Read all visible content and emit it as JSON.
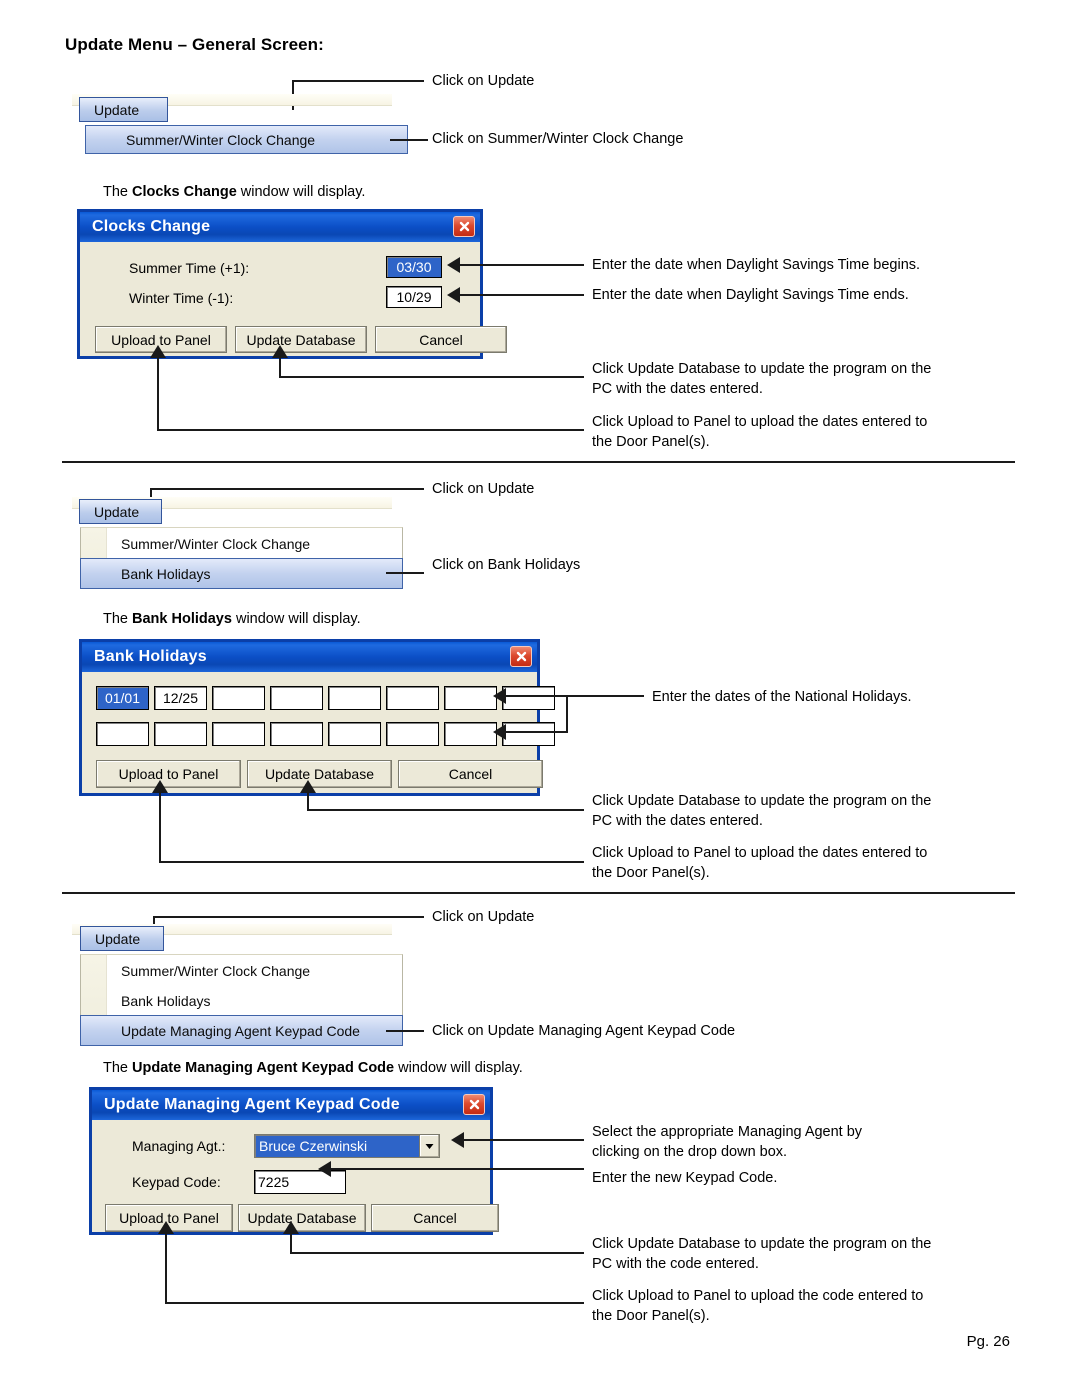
{
  "document": {
    "title": "Update Menu – General Screen:",
    "page_number": "Pg. 26"
  },
  "section1": {
    "menu": {
      "update_label": "Update",
      "items": [
        {
          "label": "Summer/Winter Clock Change",
          "selected": true
        }
      ]
    },
    "callouts": {
      "click_update": "Click on Update",
      "click_item": "Click on Summer/Winter Clock Change"
    },
    "intro_prefix": "The ",
    "intro_bold": "Clocks Change",
    "intro_suffix": " window will display.",
    "dialog": {
      "title": "Clocks Change",
      "close_icon": "close-icon",
      "fields": [
        {
          "label": "Summer Time (+1):",
          "value": "03/30",
          "selected": true
        },
        {
          "label": "Winter Time  (-1):",
          "value": "10/29",
          "selected": false
        }
      ],
      "buttons": [
        "Upload to Panel",
        "Update Database",
        "Cancel"
      ]
    },
    "annotations": {
      "summer": "Enter the date when Daylight Savings Time begins.",
      "winter": "Enter the date when Daylight Savings Time ends.",
      "update_db_l1": "Click Update Database to update the program on the",
      "update_db_l2": "PC with the dates entered.",
      "upload_l1": "Click Upload to Panel to upload the dates entered to",
      "upload_l2": "the Door Panel(s)."
    }
  },
  "section2": {
    "menu": {
      "update_label": "Update",
      "items": [
        {
          "label": "Summer/Winter Clock Change",
          "selected": false
        },
        {
          "label": "Bank Holidays",
          "selected": true
        }
      ]
    },
    "callouts": {
      "click_update": "Click on Update",
      "click_item": "Click on Bank Holidays"
    },
    "intro_prefix": "The ",
    "intro_bold": "Bank Holidays",
    "intro_suffix": " window will display.",
    "dialog": {
      "title": "Bank Holidays",
      "close_icon": "close-icon",
      "row1": [
        "01/01",
        "12/25",
        "",
        "",
        "",
        "",
        "",
        ""
      ],
      "row1_selected_index": 0,
      "row2": [
        "",
        "",
        "",
        "",
        "",
        "",
        "",
        ""
      ],
      "buttons": [
        "Upload to Panel",
        "Update Database",
        "Cancel"
      ]
    },
    "annotations": {
      "dates": "Enter the dates of the National Holidays.",
      "update_db_l1": "Click Update Database to update the program on the",
      "update_db_l2": "PC with the dates entered.",
      "upload_l1": "Click Upload to Panel to upload the dates entered to",
      "upload_l2": "the Door Panel(s)."
    }
  },
  "section3": {
    "menu": {
      "update_label": "Update",
      "items": [
        {
          "label": "Summer/Winter Clock Change",
          "selected": false
        },
        {
          "label": "Bank Holidays",
          "selected": false
        },
        {
          "label": "Update Managing Agent Keypad Code",
          "selected": true
        }
      ]
    },
    "callouts": {
      "click_update": "Click on Update",
      "click_item": "Click on Update Managing Agent Keypad Code"
    },
    "intro_prefix": "The ",
    "intro_bold": "Update Managing Agent Keypad Code",
    "intro_suffix": " window will display.",
    "dialog": {
      "title": "Update Managing Agent Keypad Code",
      "close_icon": "close-icon",
      "agent_label": "Managing Agt.:",
      "agent_value": "Bruce Czerwinski",
      "dropdown_icon": "chevron-down-icon",
      "keypad_label": "Keypad Code:",
      "keypad_value": "7225",
      "buttons": [
        "Upload to Panel",
        "Update Database",
        "Cancel"
      ]
    },
    "annotations": {
      "agent_l1": "Select the appropriate Managing Agent by",
      "agent_l2": "clicking on the drop down box.",
      "keypad": "Enter the new Keypad Code.",
      "update_db_l1": "Click Update Database to update the program on the",
      "update_db_l2": "PC with the code entered.",
      "upload_l1": "Click Upload to Panel to upload the code entered to",
      "upload_l2": "the Door Panel(s)."
    }
  }
}
